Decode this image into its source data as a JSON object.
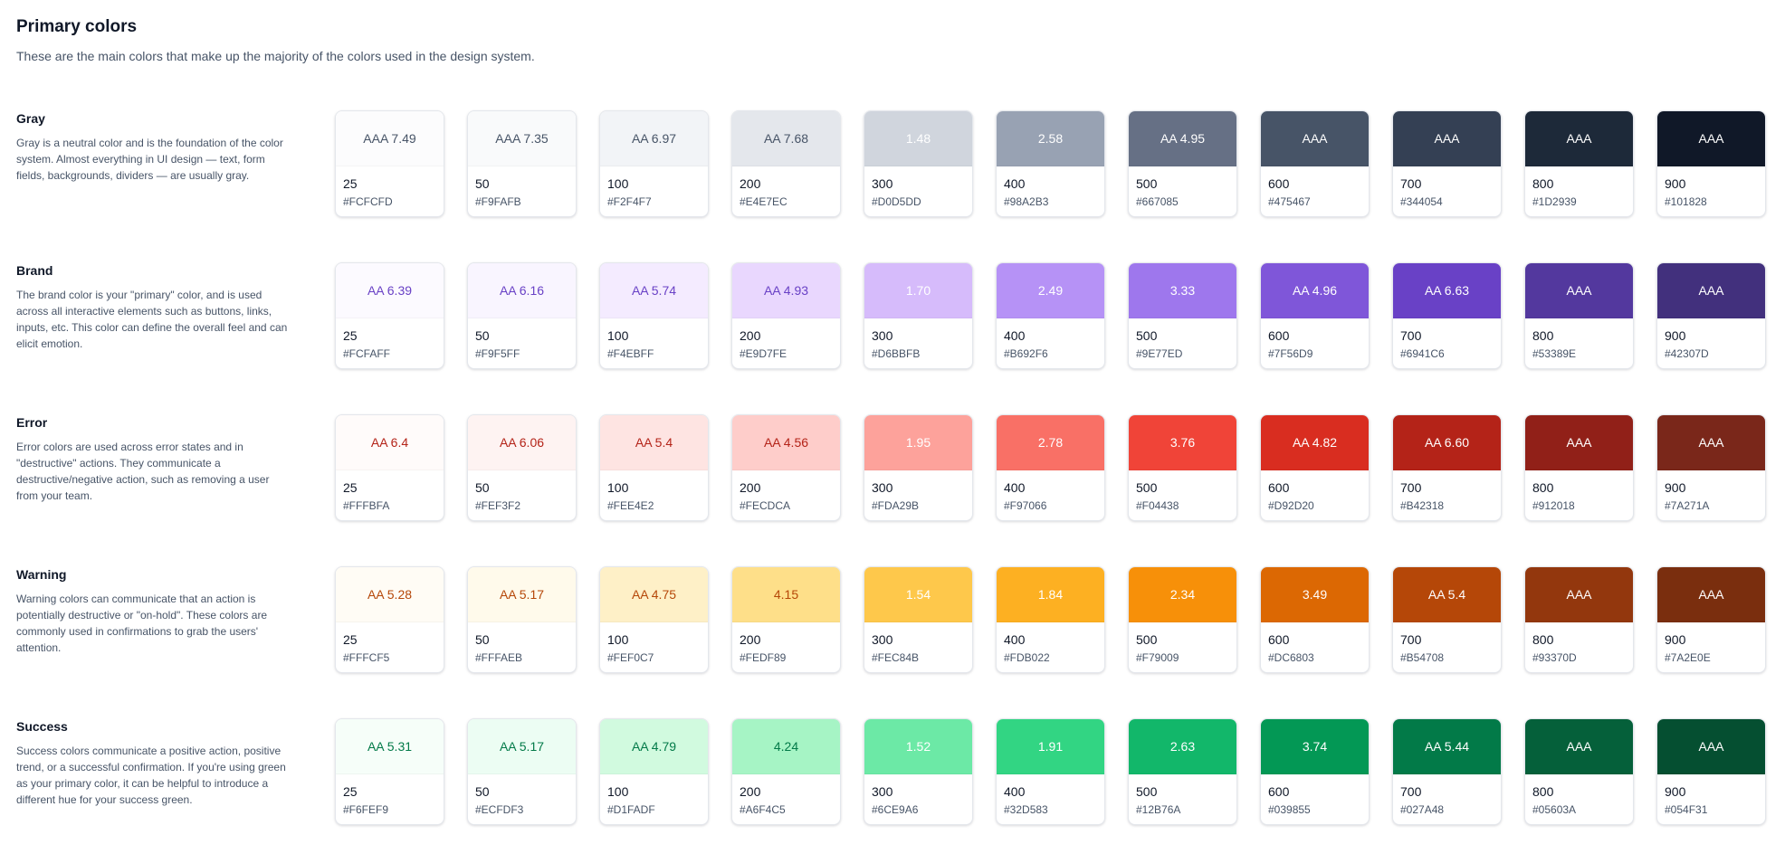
{
  "title": "Primary colors",
  "subtitle": "These are the main colors that make up the majority of the colors used in the design system.",
  "groups": [
    {
      "name": "Gray",
      "description": "Gray is a neutral color and is the foundation of the color system. Almost everything in UI design — text, form fields, backgrounds, dividers — are usually gray.",
      "swatches": [
        {
          "step": "25",
          "hex": "#FCFCFD",
          "contrast": "AAA 7.49",
          "text_color": "#475467"
        },
        {
          "step": "50",
          "hex": "#F9FAFB",
          "contrast": "AAA 7.35",
          "text_color": "#475467"
        },
        {
          "step": "100",
          "hex": "#F2F4F7",
          "contrast": "AA 6.97",
          "text_color": "#475467"
        },
        {
          "step": "200",
          "hex": "#E4E7EC",
          "contrast": "AA 7.68",
          "text_color": "#475467"
        },
        {
          "step": "300",
          "hex": "#D0D5DD",
          "contrast": "1.48",
          "text_color": "#ffffff"
        },
        {
          "step": "400",
          "hex": "#98A2B3",
          "contrast": "2.58",
          "text_color": "#ffffff"
        },
        {
          "step": "500",
          "hex": "#667085",
          "contrast": "AA 4.95",
          "text_color": "#ffffff"
        },
        {
          "step": "600",
          "hex": "#475467",
          "contrast": "AAA",
          "text_color": "#ffffff"
        },
        {
          "step": "700",
          "hex": "#344054",
          "contrast": "AAA",
          "text_color": "#ffffff"
        },
        {
          "step": "800",
          "hex": "#1D2939",
          "contrast": "AAA",
          "text_color": "#ffffff"
        },
        {
          "step": "900",
          "hex": "#101828",
          "contrast": "AAA",
          "text_color": "#ffffff"
        }
      ]
    },
    {
      "name": "Brand",
      "description": "The brand color is your \"primary\" color, and is used across all interactive elements such as buttons, links, inputs, etc. This color can define the overall feel and can elicit emotion.",
      "swatches": [
        {
          "step": "25",
          "hex": "#FCFAFF",
          "contrast": "AA 6.39",
          "text_color": "#6941C6"
        },
        {
          "step": "50",
          "hex": "#F9F5FF",
          "contrast": "AA 6.16",
          "text_color": "#6941C6"
        },
        {
          "step": "100",
          "hex": "#F4EBFF",
          "contrast": "AA 5.74",
          "text_color": "#6941C6"
        },
        {
          "step": "200",
          "hex": "#E9D7FE",
          "contrast": "AA 4.93",
          "text_color": "#6941C6"
        },
        {
          "step": "300",
          "hex": "#D6BBFB",
          "contrast": "1.70",
          "text_color": "#ffffff"
        },
        {
          "step": "400",
          "hex": "#B692F6",
          "contrast": "2.49",
          "text_color": "#ffffff"
        },
        {
          "step": "500",
          "hex": "#9E77ED",
          "contrast": "3.33",
          "text_color": "#ffffff"
        },
        {
          "step": "600",
          "hex": "#7F56D9",
          "contrast": "AA 4.96",
          "text_color": "#ffffff"
        },
        {
          "step": "700",
          "hex": "#6941C6",
          "contrast": "AA 6.63",
          "text_color": "#ffffff"
        },
        {
          "step": "800",
          "hex": "#53389E",
          "contrast": "AAA",
          "text_color": "#ffffff"
        },
        {
          "step": "900",
          "hex": "#42307D",
          "contrast": "AAA",
          "text_color": "#ffffff"
        }
      ]
    },
    {
      "name": "Error",
      "description": "Error colors are used across error states and in \"destructive\" actions. They communicate a destructive/negative action, such as removing a user from your team.",
      "swatches": [
        {
          "step": "25",
          "hex": "#FFFBFA",
          "contrast": "AA 6.4",
          "text_color": "#B42318"
        },
        {
          "step": "50",
          "hex": "#FEF3F2",
          "contrast": "AA 6.06",
          "text_color": "#B42318"
        },
        {
          "step": "100",
          "hex": "#FEE4E2",
          "contrast": "AA 5.4",
          "text_color": "#B42318"
        },
        {
          "step": "200",
          "hex": "#FECDCA",
          "contrast": "AA 4.56",
          "text_color": "#B42318"
        },
        {
          "step": "300",
          "hex": "#FDA29B",
          "contrast": "1.95",
          "text_color": "#ffffff"
        },
        {
          "step": "400",
          "hex": "#F97066",
          "contrast": "2.78",
          "text_color": "#ffffff"
        },
        {
          "step": "500",
          "hex": "#F04438",
          "contrast": "3.76",
          "text_color": "#ffffff"
        },
        {
          "step": "600",
          "hex": "#D92D20",
          "contrast": "AA 4.82",
          "text_color": "#ffffff"
        },
        {
          "step": "700",
          "hex": "#B42318",
          "contrast": "AA 6.60",
          "text_color": "#ffffff"
        },
        {
          "step": "800",
          "hex": "#912018",
          "contrast": "AAA",
          "text_color": "#ffffff"
        },
        {
          "step": "900",
          "hex": "#7A271A",
          "contrast": "AAA",
          "text_color": "#ffffff"
        }
      ]
    },
    {
      "name": "Warning",
      "description": "Warning colors can communicate that an action is potentially destructive or \"on-hold\". These colors are commonly used in confirmations to grab the users' attention.",
      "swatches": [
        {
          "step": "25",
          "hex": "#FFFCF5",
          "contrast": "AA 5.28",
          "text_color": "#B54708"
        },
        {
          "step": "50",
          "hex": "#FFFAEB",
          "contrast": "AA 5.17",
          "text_color": "#B54708"
        },
        {
          "step": "100",
          "hex": "#FEF0C7",
          "contrast": "AA 4.75",
          "text_color": "#B54708"
        },
        {
          "step": "200",
          "hex": "#FEDF89",
          "contrast": "4.15",
          "text_color": "#B54708"
        },
        {
          "step": "300",
          "hex": "#FEC84B",
          "contrast": "1.54",
          "text_color": "#ffffff"
        },
        {
          "step": "400",
          "hex": "#FDB022",
          "contrast": "1.84",
          "text_color": "#ffffff"
        },
        {
          "step": "500",
          "hex": "#F79009",
          "contrast": "2.34",
          "text_color": "#ffffff"
        },
        {
          "step": "600",
          "hex": "#DC6803",
          "contrast": "3.49",
          "text_color": "#ffffff"
        },
        {
          "step": "700",
          "hex": "#B54708",
          "contrast": "AA 5.4",
          "text_color": "#ffffff"
        },
        {
          "step": "800",
          "hex": "#93370D",
          "contrast": "AAA",
          "text_color": "#ffffff"
        },
        {
          "step": "900",
          "hex": "#7A2E0E",
          "contrast": "AAA",
          "text_color": "#ffffff"
        }
      ]
    },
    {
      "name": "Success",
      "description": "Success colors communicate a positive action, positive trend, or a successful confirmation. If you're using green as your primary color, it can be helpful to introduce a different hue for your success green.",
      "swatches": [
        {
          "step": "25",
          "hex": "#F6FEF9",
          "contrast": "AA 5.31",
          "text_color": "#027A48"
        },
        {
          "step": "50",
          "hex": "#ECFDF3",
          "contrast": "AA 5.17",
          "text_color": "#027A48"
        },
        {
          "step": "100",
          "hex": "#D1FADF",
          "contrast": "AA 4.79",
          "text_color": "#027A48"
        },
        {
          "step": "200",
          "hex": "#A6F4C5",
          "contrast": "4.24",
          "text_color": "#027A48"
        },
        {
          "step": "300",
          "hex": "#6CE9A6",
          "contrast": "1.52",
          "text_color": "#ffffff"
        },
        {
          "step": "400",
          "hex": "#32D583",
          "contrast": "1.91",
          "text_color": "#ffffff"
        },
        {
          "step": "500",
          "hex": "#12B76A",
          "contrast": "2.63",
          "text_color": "#ffffff"
        },
        {
          "step": "600",
          "hex": "#039855",
          "contrast": "3.74",
          "text_color": "#ffffff"
        },
        {
          "step": "700",
          "hex": "#027A48",
          "contrast": "AA 5.44",
          "text_color": "#ffffff"
        },
        {
          "step": "800",
          "hex": "#05603A",
          "contrast": "AAA",
          "text_color": "#ffffff"
        },
        {
          "step": "900",
          "hex": "#054F31",
          "contrast": "AAA",
          "text_color": "#ffffff"
        }
      ]
    }
  ]
}
